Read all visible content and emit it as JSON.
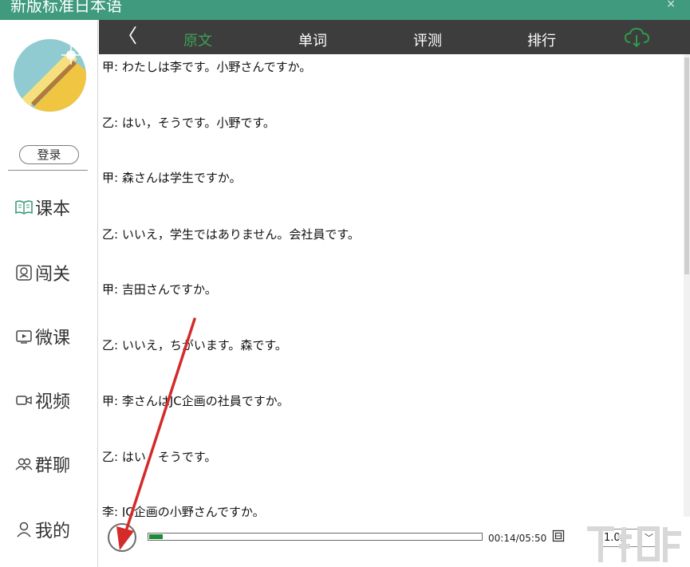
{
  "window": {
    "title": "新版标准日本语",
    "close_glyph": "×"
  },
  "sidebar": {
    "login_label": "登录",
    "items": [
      {
        "label": "课本",
        "icon": "book-icon"
      },
      {
        "label": "闯关",
        "icon": "badge-icon"
      },
      {
        "label": "微课",
        "icon": "video-screen-icon"
      },
      {
        "label": "视频",
        "icon": "camera-icon"
      },
      {
        "label": "群聊",
        "icon": "group-icon"
      },
      {
        "label": "我的",
        "icon": "person-icon"
      }
    ]
  },
  "tabs": {
    "back_glyph": "〈",
    "items": [
      {
        "label": "原文",
        "active": true
      },
      {
        "label": "单词",
        "active": false
      },
      {
        "label": "评测",
        "active": false
      },
      {
        "label": "排行",
        "active": false
      }
    ],
    "cloud_icon": "cloud-download-icon",
    "active_color": "#3fa053"
  },
  "dialogue": [
    "甲: わたしは李です。小野さんですか。",
    "乙: はい，そうです。小野です。",
    "甲: 森さんは学生ですか。",
    "乙: いいえ，学生ではありません。会社員です。",
    "甲: 吉田さんですか。",
    "乙: いいえ，ちがいます。森です。",
    "甲: 李さんはJC企画の社員ですか。",
    "乙: はい，そうです。",
    "李: JC企画の小野さんですか。"
  ],
  "player": {
    "state": "playing",
    "progress": 0.042,
    "time": "00:14/05:50",
    "speed": "1.0x",
    "accent_color": "#1f8a3a"
  },
  "colors": {
    "titlebar": "#3f9a7e",
    "tabbar": "#3d3d3d",
    "annotation": "#d42a2a"
  }
}
